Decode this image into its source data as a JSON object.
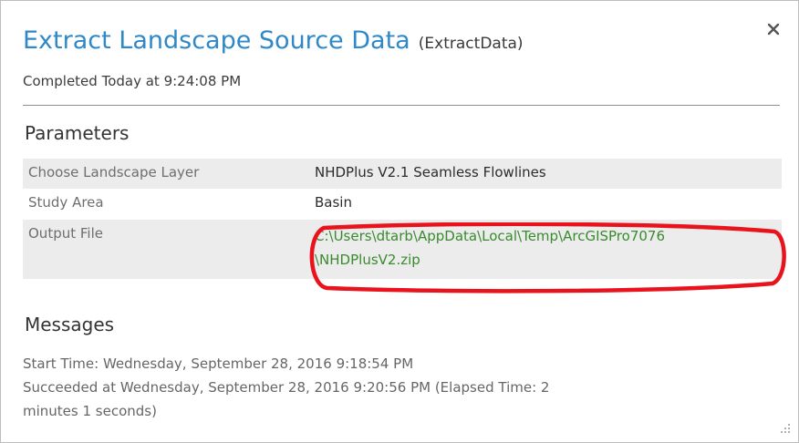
{
  "dialog": {
    "title": "Extract Landscape Source Data",
    "tool_name": "(ExtractData)",
    "status": "Completed Today at 9:24:08 PM",
    "close_icon": "close-icon",
    "accent_color": "#2f88c8",
    "link_color": "#3a8a2e",
    "highlight_color": "#e8131c"
  },
  "parameters": {
    "heading": "Parameters",
    "rows": [
      {
        "label": "Choose Landscape Layer",
        "value": "NHDPlus V2.1 Seamless Flowlines"
      },
      {
        "label": "Study Area",
        "value": "Basin"
      },
      {
        "label": "Output File",
        "value_line1": "C:\\Users\\dtarb\\AppData\\Local\\Temp\\ArcGISPro7076",
        "value_line2": "\\NHDPlusV2.zip"
      }
    ]
  },
  "messages": {
    "heading": "Messages",
    "lines": [
      "Start Time: Wednesday, September 28, 2016 9:18:54 PM",
      "Succeeded at Wednesday, September 28, 2016 9:20:56 PM (Elapsed Time: 2",
      "minutes 1 seconds)"
    ]
  }
}
